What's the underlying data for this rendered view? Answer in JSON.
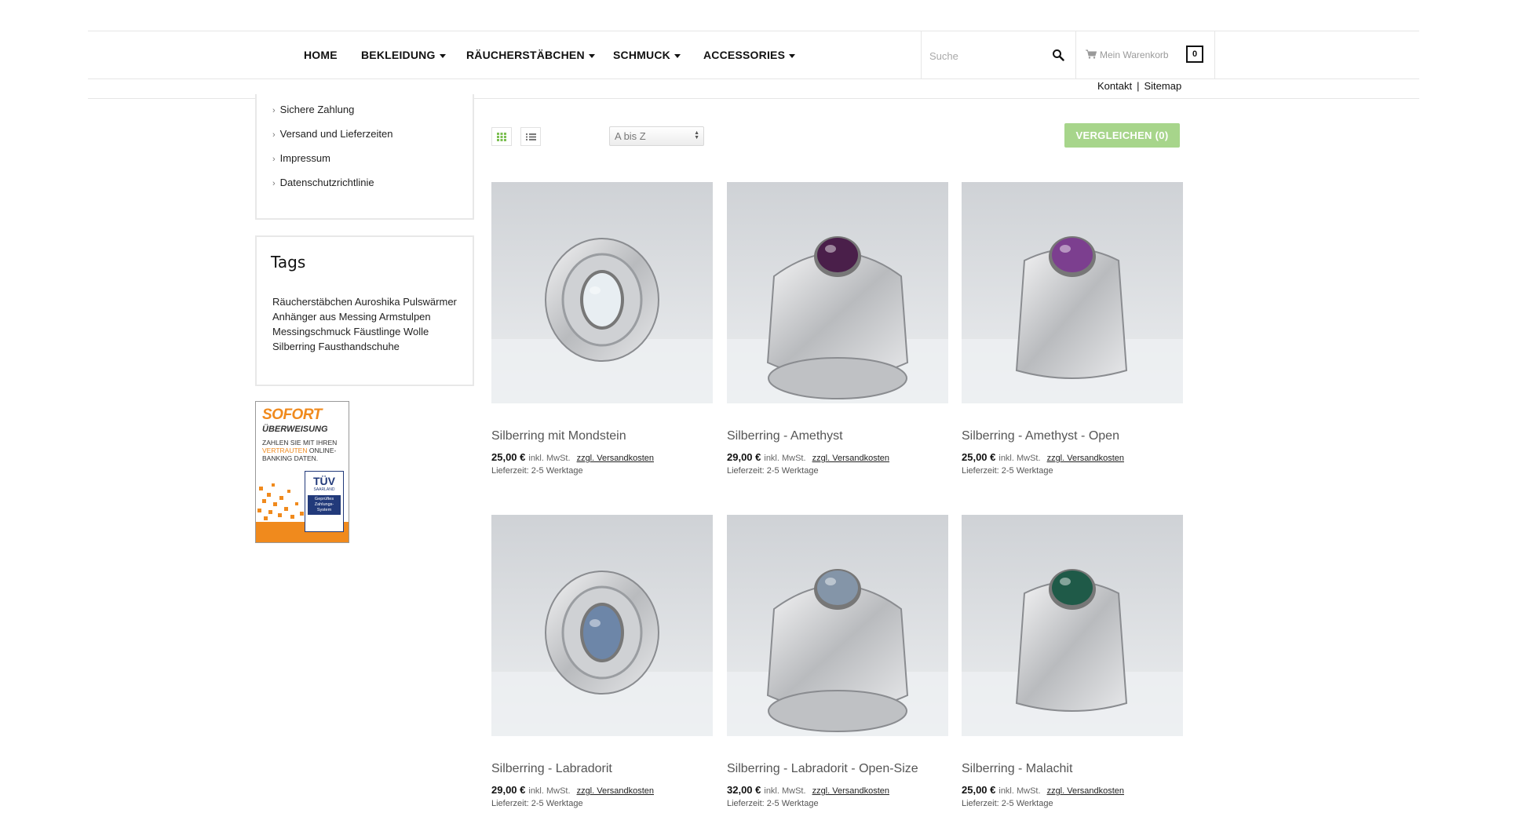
{
  "nav": {
    "items": [
      {
        "label": "HOME",
        "dropdown": false
      },
      {
        "label": "BEKLEIDUNG",
        "dropdown": true
      },
      {
        "label": "RÄUCHERSTÄBCHEN",
        "dropdown": true
      },
      {
        "label": "SCHMUCK",
        "dropdown": true
      },
      {
        "label": "ACCESSORIES",
        "dropdown": true
      }
    ],
    "search_placeholder": "Suche",
    "cart_label": "Mein Warenkorb",
    "cart_count": "0"
  },
  "toplinks": {
    "contact": "Kontakt",
    "separator": "|",
    "sitemap": "Sitemap"
  },
  "sidebar": {
    "info_links": [
      "Sichere Zahlung",
      "Versand und Lieferzeiten",
      "Impressum",
      "Datenschutzrichtlinie"
    ],
    "tags_title": "Tags",
    "tags": [
      "Räucherstäbchen",
      "Auroshika",
      "Pulswärmer",
      "Anhänger aus Messing",
      "Armstulpen",
      "Messingschmuck",
      "Fäustlinge",
      "Wolle",
      "Silberring",
      "Fausthandschuhe"
    ]
  },
  "sofort_badge": {
    "title": "SOFORT",
    "subtitle": "ÜBERWEISUNG",
    "text_before": "ZAHLEN SIE MIT IHREN",
    "text_highlight": "VERTRAUTEN",
    "text_after": "ONLINE-BANKING DATEN.",
    "tuv": "TÜV",
    "tuv_sub": "SAARLAND",
    "tuv_text": "Geprüftes Zahlungs-System"
  },
  "toolbar": {
    "sort_value": "A bis Z",
    "compare_label": "VERGLEICHEN",
    "compare_count": "(0)"
  },
  "products": [
    {
      "name": "Silberring mit Mondstein",
      "price": "25,00 €",
      "tax": "inkl. MwSt.",
      "shipping": "zzgl. Versandkosten",
      "delivery": "Lieferzeit: 2-5 Werktage",
      "stone_color": "#e8eef2"
    },
    {
      "name": "Silberring - Amethyst",
      "price": "29,00 €",
      "tax": "inkl. MwSt.",
      "shipping": "zzgl. Versandkosten",
      "delivery": "Lieferzeit: 2-5 Werktage",
      "stone_color": "#4a1f4a"
    },
    {
      "name": "Silberring - Amethyst - Open",
      "price": "25,00 €",
      "tax": "inkl. MwSt.",
      "shipping": "zzgl. Versandkosten",
      "delivery": "Lieferzeit: 2-5 Werktage",
      "stone_color": "#7c3f8f"
    },
    {
      "name": "Silberring - Labradorit",
      "price": "29,00 €",
      "tax": "inkl. MwSt.",
      "shipping": "zzgl. Versandkosten",
      "delivery": "Lieferzeit: 2-5 Werktage",
      "stone_color": "#6d86a8"
    },
    {
      "name": "Silberring - Labradorit - Open-Size",
      "price": "32,00 €",
      "tax": "inkl. MwSt.",
      "shipping": "zzgl. Versandkosten",
      "delivery": "Lieferzeit: 2-5 Werktage",
      "stone_color": "#8495a8"
    },
    {
      "name": "Silberring - Malachit",
      "price": "25,00 €",
      "tax": "inkl. MwSt.",
      "shipping": "zzgl. Versandkosten",
      "delivery": "Lieferzeit: 2-5 Werktage",
      "stone_color": "#1f5a48"
    }
  ],
  "colors": {
    "accent_green": "#a7d58b",
    "sofort_orange": "#f08a1d"
  }
}
